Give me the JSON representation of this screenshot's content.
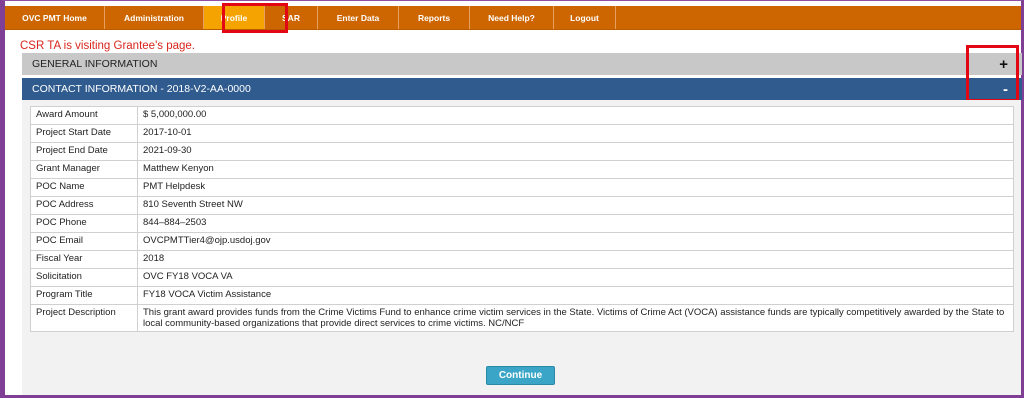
{
  "nav": {
    "items": [
      {
        "label": "OVC PMT Home"
      },
      {
        "label": "Administration"
      },
      {
        "label": "Profile"
      },
      {
        "label": "SAR"
      },
      {
        "label": "Enter Data"
      },
      {
        "label": "Reports"
      },
      {
        "label": "Need Help?"
      },
      {
        "label": "Logout"
      }
    ],
    "active": "Profile"
  },
  "notice": "CSR TA is visiting Grantee's page.",
  "sections": {
    "general": {
      "title": "GENERAL INFORMATION",
      "toggle": "+"
    },
    "contact": {
      "title": "CONTACT INFORMATION - 2018-V2-AA-0000",
      "toggle": "-"
    }
  },
  "contact_table": [
    {
      "label": "Award Amount",
      "value": "$ 5,000,000.00"
    },
    {
      "label": "Project Start Date",
      "value": "2017-10-01"
    },
    {
      "label": "Project End Date",
      "value": "2021-09-30"
    },
    {
      "label": "Grant Manager",
      "value": "Matthew Kenyon"
    },
    {
      "label": "POC Name",
      "value": "PMT Helpdesk"
    },
    {
      "label": "POC Address",
      "value": "810 Seventh Street NW"
    },
    {
      "label": "POC Phone",
      "value": "844–884–2503"
    },
    {
      "label": "POC Email",
      "value": "OVCPMTTier4@ojp.usdoj.gov"
    },
    {
      "label": "Fiscal Year",
      "value": "2018"
    },
    {
      "label": "Solicitation",
      "value": "OVC FY18 VOCA VA"
    },
    {
      "label": "Program Title",
      "value": "FY18 VOCA Victim Assistance"
    },
    {
      "label": "Project Description",
      "value": "This grant award provides funds from the Crime Victims Fund to enhance crime victim services in the State. Victims of Crime Act (VOCA) assistance funds are typically competitively awarded by the State to local community-based organizations that provide direct services to crime victims. NC/NCF"
    }
  ],
  "continue_label": "Continue",
  "colors": {
    "nav_bg": "#cd6600",
    "nav_active": "#f4a300",
    "section_blue": "#2f5b8f",
    "highlight": "#e30613",
    "button": "#3aa5c6"
  }
}
